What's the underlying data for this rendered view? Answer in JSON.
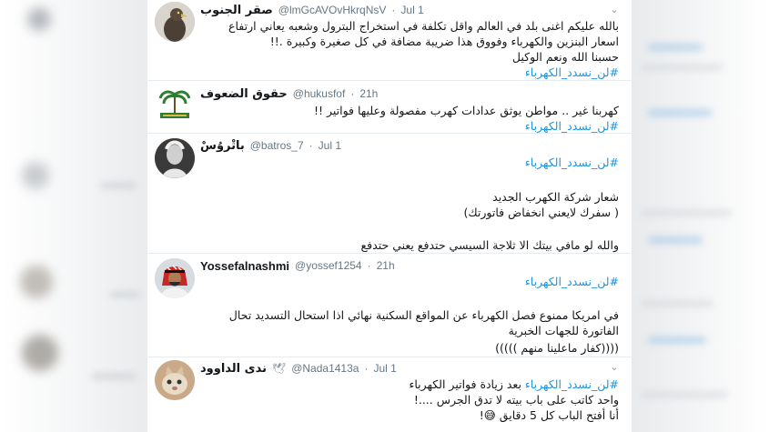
{
  "tweets": [
    {
      "name": "صقر الجنوب",
      "handle": "@lmGcAVOvHkrqNsV",
      "time": "Jul 1",
      "sep": "·",
      "lines": [
        "بالله عليكم اغنى بلد في العالم واقل تكلفة في استخراج البترول وشعبه يعاني ارتفاع",
        "اسعار البنزين والكهرباء وفووق هذا ضريبة مضافة في كل صغيرة وكبيرة .!!",
        "حسبنا الله ونعم الوكيل"
      ],
      "hashtag": "#لن_نسدد_الكهرباء"
    },
    {
      "name": "حقوق الضعوف",
      "handle": "@hukusfof",
      "time": "21h",
      "sep": "·",
      "lines": [
        "كهربنا غير .. مواطن يوثق عدادات كهرب مفصولة وعليها فواتير !!"
      ],
      "hashtag": "#لن_نسدد_الكهرباء"
    },
    {
      "name": "باتْروُسْ",
      "handle": "@batros_7",
      "time": "Jul 1",
      "sep": "·",
      "hashtag_top": "#لن_نسدد_الكهرباء",
      "lines": [
        "شعار شركة الكهرب الجديد",
        "( سفرك لايعني انخفاض فاتورتك)",
        "والله لو مافي بيتك الا ثلاجة السيسي  حتدفع يعني حتدفع"
      ]
    },
    {
      "name": "Yossefalnashmi",
      "handle": "@yossef1254",
      "time": "21h",
      "sep": "·",
      "hashtag_top": "#لن_نسدد_الكهرباء",
      "lines": [
        "في امريكا ممنوع فصل الكهرباء عن المواقع السكنية نهائي  اذا استحال التسديد تحال",
        "الفاتورة للجهات الخبرية",
        "((((كفار ماعلينا منهم )))))"
      ]
    },
    {
      "name": "ندى الداوود",
      "name_icon": "🕊",
      "handle": "@Nada1413a",
      "time": "Jul 1",
      "sep": "·",
      "lines": [
        "بعد زيادة فواتير الكهرباء",
        "واحد كاتب على باب بيته لا تدق الجرس ....!",
        "أنا أفتح الباب كل 5 دقايق 😅!"
      ],
      "hashtag_inline": "#لن_نسدد_الكهرباء"
    }
  ],
  "colors": {
    "link": "#1b95e0",
    "secondary": "#657786",
    "divider": "#e6ecf0"
  },
  "icons": {
    "menu": "chevron-down-icon"
  }
}
